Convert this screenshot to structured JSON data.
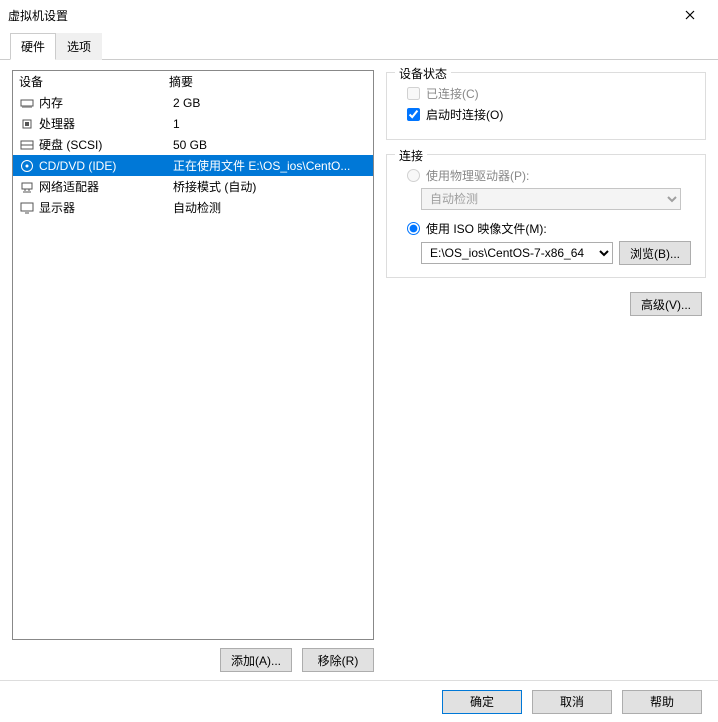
{
  "window": {
    "title": "虚拟机设置"
  },
  "tabs": {
    "hardware": "硬件",
    "options": "选项"
  },
  "list": {
    "header_device": "设备",
    "header_summary": "摘要",
    "rows": [
      {
        "name": "内存",
        "summary": "2 GB",
        "icon": "memory"
      },
      {
        "name": "处理器",
        "summary": "1",
        "icon": "cpu"
      },
      {
        "name": "硬盘 (SCSI)",
        "summary": "50 GB",
        "icon": "disk"
      },
      {
        "name": "CD/DVD (IDE)",
        "summary": "正在使用文件 E:\\OS_ios\\CentO...",
        "icon": "cd",
        "selected": true
      },
      {
        "name": "网络适配器",
        "summary": "桥接模式 (自动)",
        "icon": "net"
      },
      {
        "name": "显示器",
        "summary": "自动检测",
        "icon": "monitor"
      }
    ],
    "add_btn": "添加(A)...",
    "remove_btn": "移除(R)"
  },
  "status_group": {
    "title": "设备状态",
    "connected": "已连接(C)",
    "connect_on_power": "启动时连接(O)"
  },
  "connect_group": {
    "title": "连接",
    "physical": "使用物理驱动器(P):",
    "physical_combo": "自动检测",
    "iso": "使用 ISO 映像文件(M):",
    "iso_path": "E:\\OS_ios\\CentOS-7-x86_64",
    "browse": "浏览(B)..."
  },
  "advanced_btn": "高级(V)...",
  "footer": {
    "ok": "确定",
    "cancel": "取消",
    "help": "帮助"
  }
}
